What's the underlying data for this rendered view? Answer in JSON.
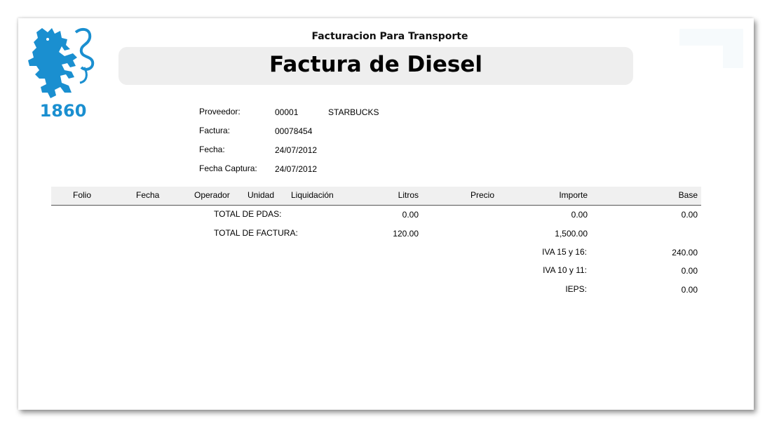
{
  "logo": {
    "year": "1860",
    "color": "#1a8fd0",
    "icon": "lion-crest-icon"
  },
  "header": {
    "company": "Facturacion Para Transporte",
    "title": "Factura de Diesel"
  },
  "info": {
    "proveedor_label": "Proveedor:",
    "proveedor_code": "00001",
    "proveedor_name": "STARBUCKS",
    "factura_label": "Factura:",
    "factura_value": "00078454",
    "fecha_label": "Fecha:",
    "fecha_value": "24/07/2012",
    "captura_label": "Fecha Captura:",
    "captura_value": "24/07/2012"
  },
  "table": {
    "columns": [
      "Folio",
      "Fecha",
      "Operador",
      "Unidad",
      "Liquidación",
      "Litros",
      "Precio",
      "Importe",
      "Base"
    ]
  },
  "totals": {
    "pdas_label": "TOTAL DE PDAS:",
    "pdas_litros": "0.00",
    "pdas_importe": "0.00",
    "pdas_base": "0.00",
    "factura_label": "TOTAL DE FACTURA:",
    "factura_litros": "120.00",
    "factura_importe": "1,500.00",
    "iva16_label": "IVA 15 y 16:",
    "iva16_value": "240.00",
    "iva11_label": "IVA 10 y 11:",
    "iva11_value": "0.00",
    "ieps_label": "IEPS:",
    "ieps_value": "0.00"
  }
}
